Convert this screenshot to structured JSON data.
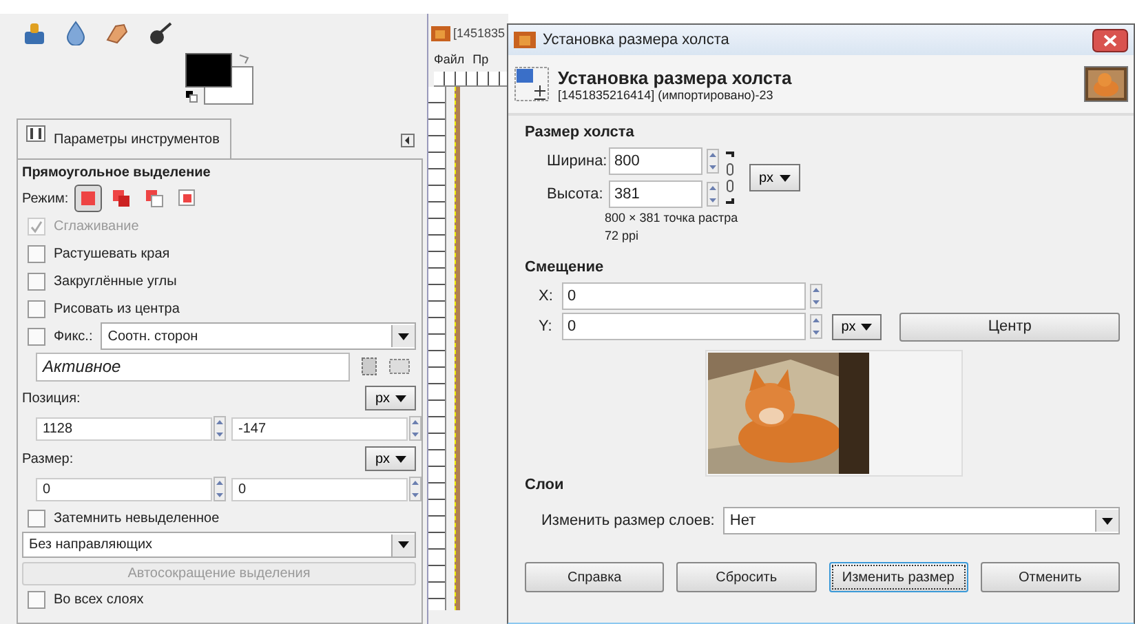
{
  "toolbox": {
    "tab": {
      "label": "Параметры инструментов"
    },
    "tool_title": "Прямоугольное выделение",
    "mode": {
      "label": "Режим:",
      "options": [
        {
          "selected": true
        },
        {
          "selected": false
        },
        {
          "selected": false
        },
        {
          "selected": false
        }
      ]
    },
    "checkboxes": [
      {
        "label": "Сглаживание",
        "checked": true,
        "disabled": true
      },
      {
        "label": "Растушевать края",
        "checked": false,
        "disabled": false
      },
      {
        "label": "Закруглённые углы",
        "checked": false,
        "disabled": false
      },
      {
        "label": "Рисовать из центра",
        "checked": false,
        "disabled": false
      }
    ],
    "fixed": {
      "label": "Фикс.:",
      "checked": false,
      "value": "Соотн. сторон"
    },
    "fixed_field": "Активное",
    "position": {
      "label": "Позиция:",
      "unit": "px",
      "values": [
        "1128",
        "-147"
      ]
    },
    "size": {
      "label": "Размер:",
      "unit": "px",
      "values": [
        "0",
        "0"
      ]
    },
    "darken": {
      "label": "Затемнить невыделенное",
      "checked": false
    },
    "guides": "Без направляющих",
    "auto_shrink": {
      "label": "Автосокращение выделения",
      "disabled": true
    },
    "all_layers": {
      "label": "Во всех слоях",
      "checked": false
    }
  },
  "image_window": {
    "title": "[1451835",
    "menu": [
      "Файл",
      "Пр"
    ]
  },
  "dialog": {
    "title": "Установка размера холста",
    "header_title": "Установка размера холста",
    "header_subtitle": "[1451835216414] (импортировано)-23",
    "canvas_size": {
      "heading": "Размер холста",
      "fields": [
        {
          "label": "Ширина:",
          "value": "800"
        },
        {
          "label": "Высота:",
          "value": "381"
        }
      ],
      "unit": "px",
      "info": [
        "800 × 381 точка растра",
        "72 ppi"
      ]
    },
    "offset": {
      "heading": "Смещение",
      "fields": [
        {
          "label": "X:",
          "value": "0"
        },
        {
          "label": "Y:",
          "value": "0"
        }
      ],
      "unit": "px",
      "center_button": "Центр"
    },
    "layers": {
      "heading": "Слои",
      "label": "Изменить размер слоев:",
      "value": "Нет"
    },
    "buttons": [
      {
        "label": "Справка",
        "focused": false
      },
      {
        "label": "Сбросить",
        "focused": false
      },
      {
        "label": "Изменить размер",
        "focused": true
      },
      {
        "label": "Отменить",
        "focused": false
      }
    ]
  }
}
